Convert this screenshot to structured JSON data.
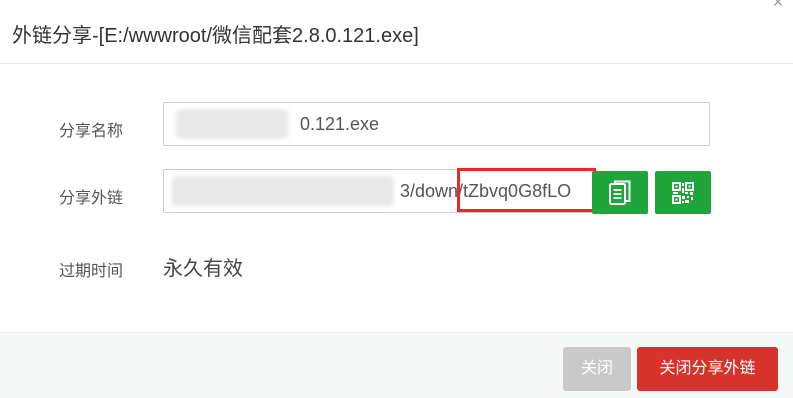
{
  "dialog": {
    "title": "外链分享-[E:/wwwroot/微信配套2.8.0.121.exe]",
    "close_glyph": "×"
  },
  "form": {
    "name_label": "分享名称",
    "name_value": "0.121.exe",
    "link_label": "分享外链",
    "link_value": "3/down/tZbvq0G8fLO",
    "expire_label": "过期时间",
    "expire_value": "永久有效"
  },
  "buttons": {
    "copy_icon": "copy-icon",
    "qrcode_icon": "qrcode-icon",
    "close_label": "关闭",
    "close_share_label": "关闭分享外链"
  },
  "colors": {
    "accent_green": "#20a53a",
    "danger_red": "#d5332c",
    "disabled_gray": "#c9c9c9",
    "highlight_red": "#e8282b"
  }
}
